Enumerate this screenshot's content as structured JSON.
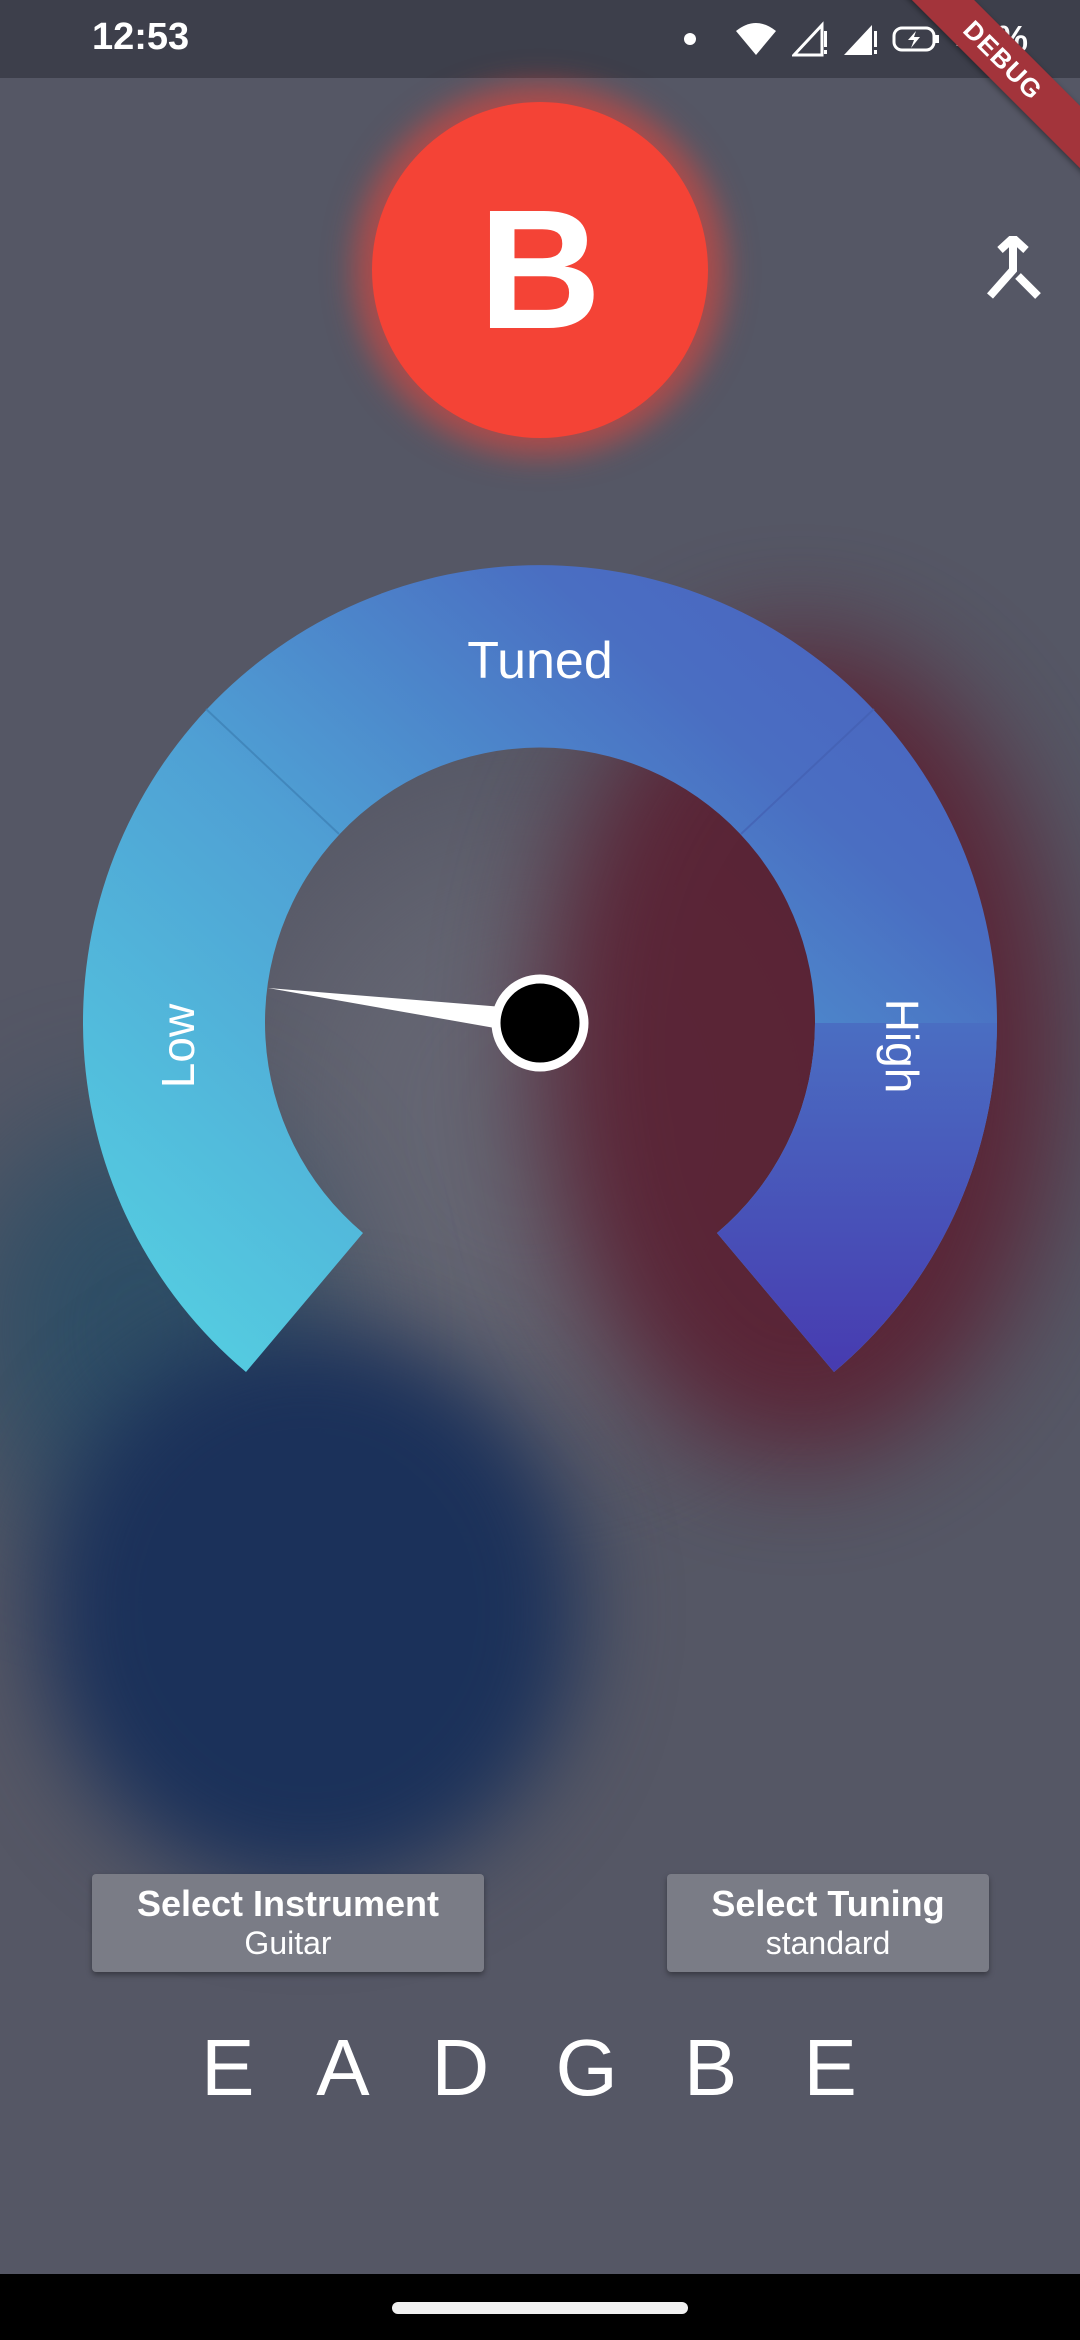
{
  "status_bar": {
    "time": "12:53",
    "battery": "41%",
    "icons": [
      "notification-dot-icon",
      "wifi-icon",
      "signal-icon",
      "signal-icon",
      "battery-charging-icon"
    ]
  },
  "debug_banner": "DEBUG",
  "note": {
    "letter": "B",
    "color": "#f44336"
  },
  "toolbar": {
    "icon": "merge-icon"
  },
  "gauge": {
    "label_low": "Low",
    "label_tuned": "Tuned",
    "label_high": "High",
    "colors": {
      "low": "#55d5e3",
      "tuned": "#4c7fc8",
      "high": "#473bb0"
    },
    "needle_fraction": 0.07
  },
  "buttons": {
    "instrument": {
      "title": "Select Instrument",
      "value": "Guitar"
    },
    "tuning": {
      "title": "Select Tuning",
      "value": "standard"
    }
  },
  "tuning_strings": "E A D G B E"
}
